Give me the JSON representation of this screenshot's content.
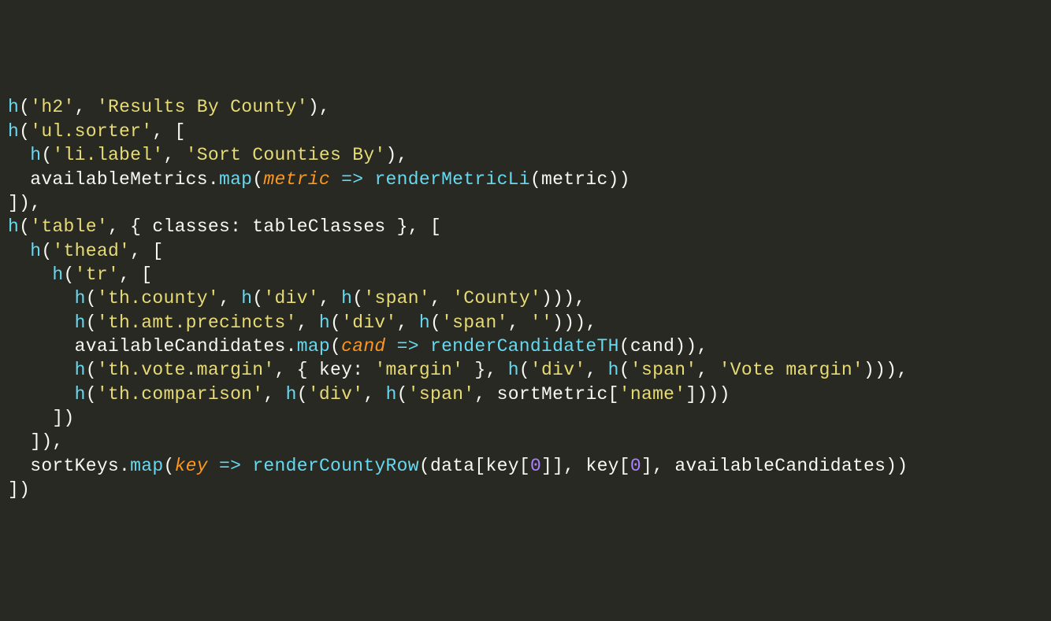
{
  "code": {
    "l1": {
      "fn": "h",
      "p1": "(",
      "s1": "'h2'",
      "c1": ", ",
      "s2": "'Results By County'",
      "p2": "),"
    },
    "l2": {
      "fn": "h",
      "p1": "(",
      "s1": "'ul.sorter'",
      "c1": ", [",
      "end": ""
    },
    "l3": {
      "indent": "  ",
      "fn": "h",
      "p1": "(",
      "s1": "'li.label'",
      "c1": ", ",
      "s2": "'Sort Counties By'",
      "p2": "),"
    },
    "l4": {
      "indent": "  ",
      "id1": "availableMetrics",
      "dot": ".",
      "fn": "map",
      "p1": "(",
      "param": "metric",
      "sp1": " ",
      "arrow": "=>",
      "sp2": " ",
      "call": "renderMetricLi",
      "p2": "(",
      "id2": "metric",
      "p3": "))"
    },
    "l5": {
      "txt": "]),"
    },
    "l6": {
      "fn": "h",
      "p1": "(",
      "s1": "'table'",
      "c1": ", { ",
      "id1": "classes",
      "colon": ": ",
      "id2": "tableClasses",
      "c2": " }, ["
    },
    "l7": {
      "indent": "  ",
      "fn": "h",
      "p1": "(",
      "s1": "'thead'",
      "c1": ", ["
    },
    "l8": {
      "indent": "    ",
      "fn": "h",
      "p1": "(",
      "s1": "'tr'",
      "c1": ", ["
    },
    "l9": {
      "indent": "      ",
      "fn1": "h",
      "p1": "(",
      "s1": "'th.county'",
      "c1": ", ",
      "fn2": "h",
      "p2": "(",
      "s2": "'div'",
      "c2": ", ",
      "fn3": "h",
      "p3": "(",
      "s3": "'span'",
      "c3": ", ",
      "s4": "'County'",
      "p4": "))),"
    },
    "l10": {
      "indent": "      ",
      "fn1": "h",
      "p1": "(",
      "s1": "'th.amt.precincts'",
      "c1": ", ",
      "fn2": "h",
      "p2": "(",
      "s2": "'div'",
      "c2": ", ",
      "fn3": "h",
      "p3": "(",
      "s3": "'span'",
      "c3": ", ",
      "s4": "''",
      "p4": "))),"
    },
    "l11": {
      "indent": "      ",
      "id1": "availableCandidates",
      "dot": ".",
      "fn": "map",
      "p1": "(",
      "param": "cand",
      "sp1": " ",
      "arrow": "=>",
      "sp2": " ",
      "call": "renderCandidateTH",
      "p2": "(",
      "id2": "cand",
      "p3": ")),"
    },
    "l12": {
      "indent": "      ",
      "fn1": "h",
      "p1": "(",
      "s1": "'th.vote.margin'",
      "c1": ", { ",
      "id1": "key",
      "colon": ": ",
      "s2": "'margin'",
      "c2": " }, ",
      "fn2": "h",
      "p2": "(",
      "s3": "'div'",
      "c3": ", ",
      "fn3": "h",
      "p3": "(",
      "s4": "'span'",
      "c4": ", ",
      "s5": "'Vote margin'",
      "p4": "))),"
    },
    "l13": {
      "indent": "      ",
      "fn1": "h",
      "p1": "(",
      "s1": "'th.comparison'",
      "c1": ", ",
      "fn2": "h",
      "p2": "(",
      "s2": "'div'",
      "c2": ", ",
      "fn3": "h",
      "p3": "(",
      "s3": "'span'",
      "c3": ", ",
      "id1": "sortMetric",
      "br1": "[",
      "s4": "'name'",
      "br2": "]",
      "p4": ")))"
    },
    "l14": {
      "indent": "    ",
      "txt": "])"
    },
    "l15": {
      "indent": "  ",
      "txt": "]),"
    },
    "l16": {
      "indent": "  ",
      "id1": "sortKeys",
      "dot": ".",
      "fn": "map",
      "p1": "(",
      "param": "key",
      "sp1": " ",
      "arrow": "=>",
      "sp2": " ",
      "call": "renderCountyRow",
      "p2": "(",
      "id2": "data",
      "br1": "[",
      "id3": "key",
      "br2": "[",
      "n1": "0",
      "br3": "]], ",
      "id4": "key",
      "br4": "[",
      "n2": "0",
      "br5": "], ",
      "id5": "availableCandidates",
      "p3": "))"
    },
    "l17": {
      "txt": "])"
    }
  }
}
